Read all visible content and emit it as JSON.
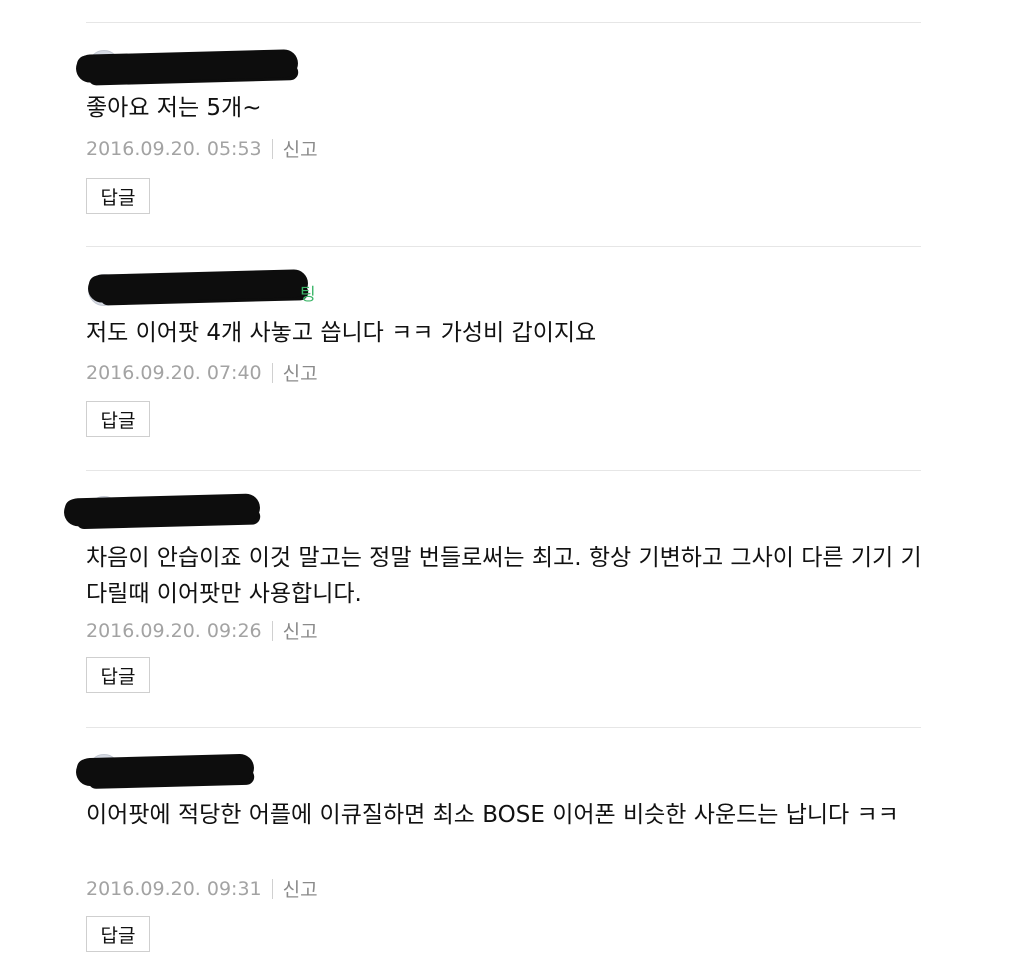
{
  "comments": [
    {
      "nickname_visible_suffix": "",
      "text": "좋아요 저는 5개~",
      "date": "2016.09.20. 05:53",
      "report_label": "신고",
      "reply_label": "답글"
    },
    {
      "nickname_visible_suffix": "팅",
      "text": "저도 이어팟 4개 사놓고 씁니다 ㅋㅋ 가성비 갑이지요",
      "date": "2016.09.20. 07:40",
      "report_label": "신고",
      "reply_label": "답글"
    },
    {
      "nickname_visible_suffix": "",
      "text": "차음이 안습이죠 이것 말고는 정말 번들로써는 최고. 항상 기변하고 그사이 다른 기기 기다릴때 이어팟만 사용합니다.",
      "date": "2016.09.20. 09:26",
      "report_label": "신고",
      "reply_label": "답글"
    },
    {
      "nickname_visible_suffix": "",
      "text": "이어팟에 적당한 어플에 이큐질하면 최소 BOSE 이어폰 비슷한 사운드는 납니다 ㅋㅋ",
      "date": "2016.09.20. 09:31",
      "report_label": "신고",
      "reply_label": "답글"
    }
  ],
  "colors": {
    "divider": "#e6e6e6",
    "meta_text": "#a3a3a3",
    "nickname_accent": "#3db66a",
    "redaction": "#0d0d0d"
  }
}
